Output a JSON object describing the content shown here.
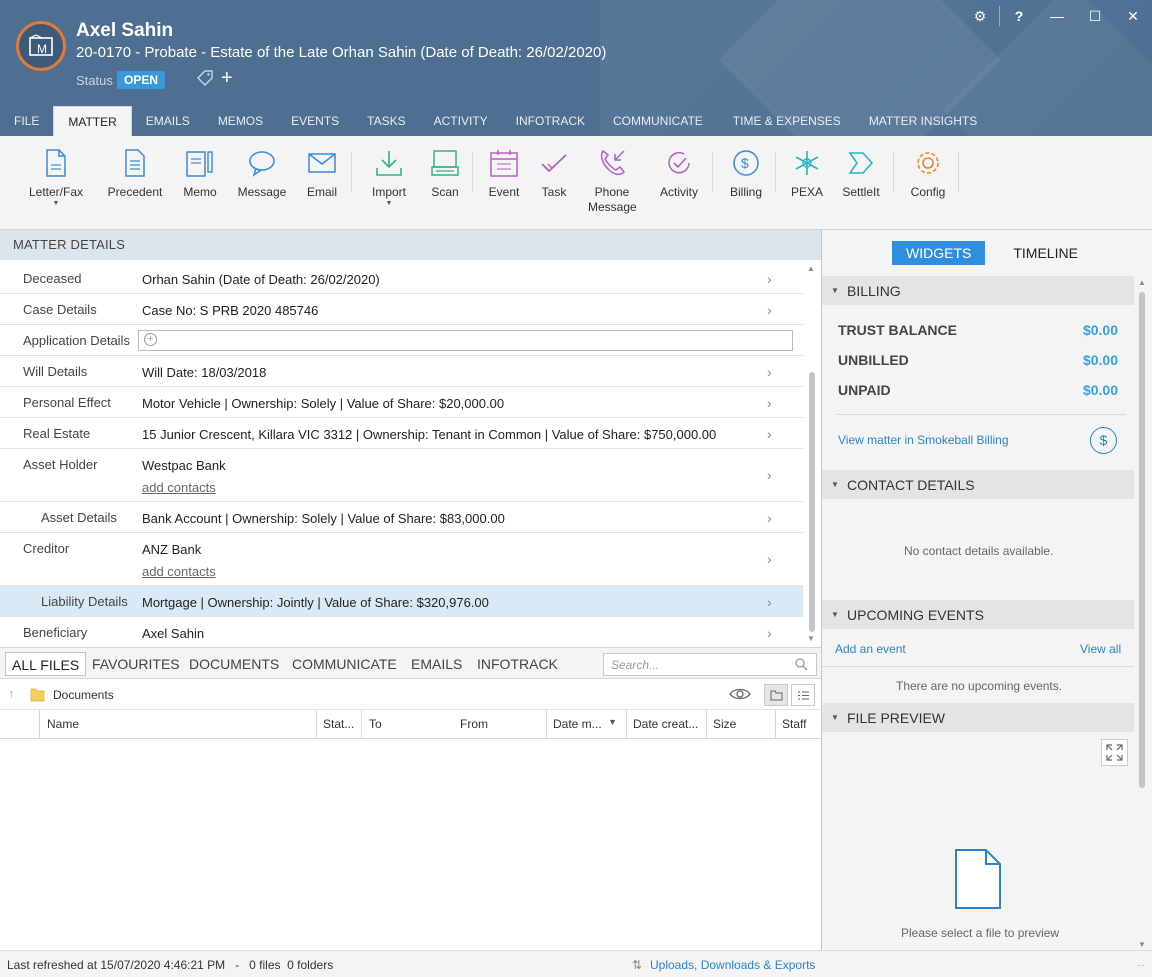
{
  "header": {
    "client_name": "Axel Sahin",
    "matter_title": "20-0170 - Probate - Estate of the Late Orhan Sahin (Date of Death: 26/02/2020)",
    "status_label": "Status",
    "status_value": "OPEN",
    "window_controls": {
      "settings": "⚙",
      "help": "?",
      "minimize": "—",
      "maximize": "☐",
      "close": "✕"
    },
    "colors": {
      "header_bg": "#4e6f92",
      "accent_orange": "#e07b39",
      "status_blue": "#3a9ad9"
    }
  },
  "tabs": [
    "FILE",
    "MATTER",
    "EMAILS",
    "MEMOS",
    "EVENTS",
    "TASKS",
    "ACTIVITY",
    "INFOTRACK",
    "COMMUNICATE",
    "TIME & EXPENSES",
    "MATTER INSIGHTS"
  ],
  "active_tab": "MATTER",
  "ribbon": [
    {
      "label": "Letter/Fax",
      "icon": "letter-icon",
      "dropdown": true
    },
    {
      "label": "Precedent",
      "icon": "precedent-icon"
    },
    {
      "label": "Memo",
      "icon": "memo-icon"
    },
    {
      "label": "Message",
      "icon": "message-icon"
    },
    {
      "label": "Email",
      "icon": "email-icon"
    },
    {
      "label": "Import",
      "icon": "import-icon",
      "dropdown": true
    },
    {
      "label": "Scan",
      "icon": "scan-icon"
    },
    {
      "label": "Event",
      "icon": "event-icon"
    },
    {
      "label": "Task",
      "icon": "task-icon"
    },
    {
      "label": "Phone Message",
      "line1": "Phone",
      "line2": "Message",
      "icon": "phone-message-icon"
    },
    {
      "label": "Activity",
      "icon": "activity-icon"
    },
    {
      "label": "Billing",
      "icon": "billing-icon"
    },
    {
      "label": "PEXA",
      "icon": "pexa-icon"
    },
    {
      "label": "SettleIt",
      "icon": "settleit-icon"
    },
    {
      "label": "Config",
      "icon": "config-icon"
    }
  ],
  "matter_details": {
    "title": "MATTER DETAILS",
    "rows": [
      {
        "key": "Deceased",
        "value": "Orhan Sahin (Date of Death: 26/02/2020)"
      },
      {
        "key": "Case Details",
        "value": "Case No: S PRB 2020 485746"
      },
      {
        "key": "Application Details",
        "value": ""
      },
      {
        "key": "Will Details",
        "value": "Will Date: 18/03/2018"
      },
      {
        "key": "Personal Effect",
        "value": "Motor Vehicle | Ownership: Solely | Value of Share: $20,000.00"
      },
      {
        "key": "Real Estate",
        "value": "15 Junior Crescent, Killara VIC 3312 | Ownership: Tenant in Common | Value of Share: $750,000.00"
      },
      {
        "key": "Asset Holder",
        "value": "Westpac Bank",
        "link": "add contacts"
      },
      {
        "key": "Asset Details",
        "value": "Bank Account | Ownership: Solely | Value of Share: $83,000.00"
      },
      {
        "key": "Creditor",
        "value": "ANZ Bank",
        "link": "add contacts"
      },
      {
        "key": "Liability Details",
        "value": "Mortgage | Ownership: Jointly | Value of Share: $320,976.00"
      },
      {
        "key": "Beneficiary",
        "value": "Axel Sahin"
      }
    ]
  },
  "files": {
    "tabs": [
      "ALL FILES",
      "FAVOURITES",
      "DOCUMENTS",
      "COMMUNICATE",
      "EMAILS",
      "INFOTRACK"
    ],
    "active_tab": "ALL FILES",
    "search_placeholder": "Search...",
    "breadcrumb": "Documents",
    "columns": [
      "Name",
      "Stat...",
      "To",
      "From",
      "Date m...",
      "Date creat...",
      "Size",
      "Staff"
    ]
  },
  "statusbar": {
    "left": "Last refreshed at 15/07/2020 4:46:21 PM   -   0 files  0 folders",
    "right": "Uploads, Downloads & Exports"
  },
  "right_panel": {
    "toggle": [
      "WIDGETS",
      "TIMELINE"
    ],
    "active": "WIDGETS",
    "billing": {
      "title": "BILLING",
      "rows": [
        {
          "label": "TRUST BALANCE",
          "amount": "$0.00"
        },
        {
          "label": "UNBILLED",
          "amount": "$0.00"
        },
        {
          "label": "UNPAID",
          "amount": "$0.00"
        }
      ],
      "link": "View matter in Smokeball Billing"
    },
    "contact": {
      "title": "CONTACT DETAILS",
      "empty": "No contact details available."
    },
    "events": {
      "title": "UPCOMING EVENTS",
      "add": "Add an event",
      "view_all": "View all",
      "empty": "There are no upcoming events."
    },
    "preview": {
      "title": "FILE PREVIEW",
      "empty": "Please select a file to preview"
    }
  }
}
